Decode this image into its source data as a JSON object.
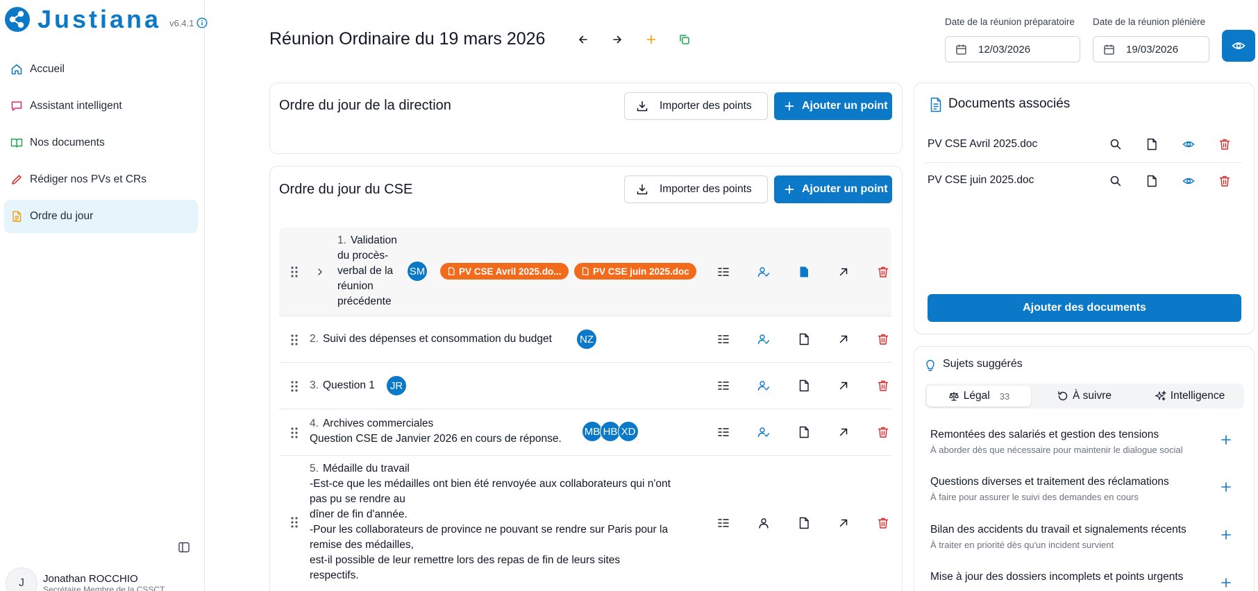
{
  "app": {
    "name": "Justiana",
    "version": "v6.4.1"
  },
  "nav": [
    {
      "label": "Accueil",
      "icon": "home-icon"
    },
    {
      "label": "Assistant intelligent",
      "icon": "chat-icon"
    },
    {
      "label": "Nos documents",
      "icon": "book-icon"
    },
    {
      "label": "Rédiger nos PVs et CRs",
      "icon": "pencil-icon"
    },
    {
      "label": "Ordre du jour",
      "icon": "document-icon",
      "active": true
    }
  ],
  "user": {
    "initial": "J",
    "name": "Jonathan ROCCHIO",
    "role": "Secrétaire Membre de la CSSCT"
  },
  "header": {
    "title": "Réunion Ordinaire du 19 mars 2026",
    "prep_label": "Date de la réunion préparatoire",
    "prep_date": "12/03/2026",
    "plen_label": "Date de la réunion plénière",
    "plen_date": "19/03/2026"
  },
  "direction": {
    "title": "Ordre du jour de la direction",
    "import_label": "Importer des points",
    "add_label": "Ajouter un point"
  },
  "cse": {
    "title": "Ordre du jour du CSE",
    "import_label": "Importer des points",
    "add_label": "Ajouter un point",
    "items": [
      {
        "number": "1.",
        "lines": [
          "Validation",
          "du procès-",
          "verbal de la",
          "réunion",
          "précédente"
        ],
        "avatars": [
          "SM"
        ],
        "chips": [
          "PV CSE Avril 2025.do...",
          "PV CSE juin 2025.doc"
        ]
      },
      {
        "number": "2.",
        "title": "Suivi des dépenses et consommation du budget",
        "avatars": [
          "NZ"
        ]
      },
      {
        "number": "3.",
        "title": "Question 1",
        "avatars": [
          "JR"
        ]
      },
      {
        "number": "4.",
        "title": "Archives commerciales",
        "subtitle": "Question CSE de Janvier 2026 en cours de réponse.",
        "avatars": [
          "MB",
          "HB",
          "XD"
        ]
      },
      {
        "number": "5.",
        "title": "Médaille du travail",
        "body": [
          "-Est-ce que les médailles ont bien été renvoyée aux collaborateurs qui n'ont",
          "pas pu se rendre au",
          "dîner de fin d'année.",
          "-Pour les collaborateurs de province ne pouvant se rendre sur Paris pour la",
          "remise des médailles,",
          "est-il possible de leur remettre lors des repas de fin de leurs sites",
          "respectifs."
        ]
      }
    ]
  },
  "documents": {
    "title": "Documents associés",
    "files": [
      "PV CSE Avril 2025.doc",
      "PV CSE juin 2025.doc"
    ],
    "add_label": "Ajouter des documents"
  },
  "suggestions": {
    "title": "Sujets suggérés",
    "tabs": [
      {
        "label": "Légal",
        "count": "33",
        "icon": "scale-icon"
      },
      {
        "label": "À suivre",
        "icon": "history-icon"
      },
      {
        "label": "Intelligence",
        "icon": "sparkle-icon"
      }
    ],
    "items": [
      {
        "title": "Remontées des salariés et gestion des tensions",
        "sub": "À aborder dès que nécessaire pour maintenir le dialogue social"
      },
      {
        "title": "Questions diverses et traitement des réclamations",
        "sub": "À faire pour assurer le suivi des demandes en cours"
      },
      {
        "title": "Bilan des accidents du travail et signalements récents",
        "sub": "À traiter en priorité dès qu'un incident survient"
      },
      {
        "title": "Mise à jour des dossiers incomplets et points urgents",
        "sub": ""
      }
    ]
  },
  "colors": {
    "primary": "#0b79c7",
    "chip": "#f26a1b",
    "danger": "#dc2626",
    "active_nav": "#e6f4fb"
  }
}
